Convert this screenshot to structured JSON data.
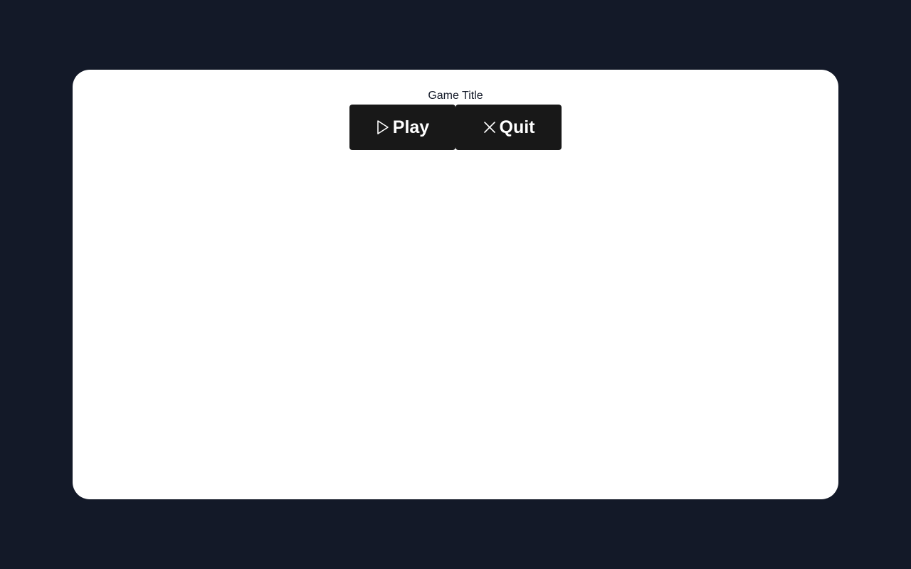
{
  "game": {
    "title": "Game Title"
  },
  "menu": {
    "buttons": [
      {
        "label": "Play",
        "icon": "play-icon"
      },
      {
        "label": "Quit",
        "icon": "close-icon"
      }
    ]
  },
  "colors": {
    "background": "#131928",
    "card": "#ffffff",
    "button": "#181818",
    "button_text": "#ffffff",
    "title_text": "#131928"
  }
}
